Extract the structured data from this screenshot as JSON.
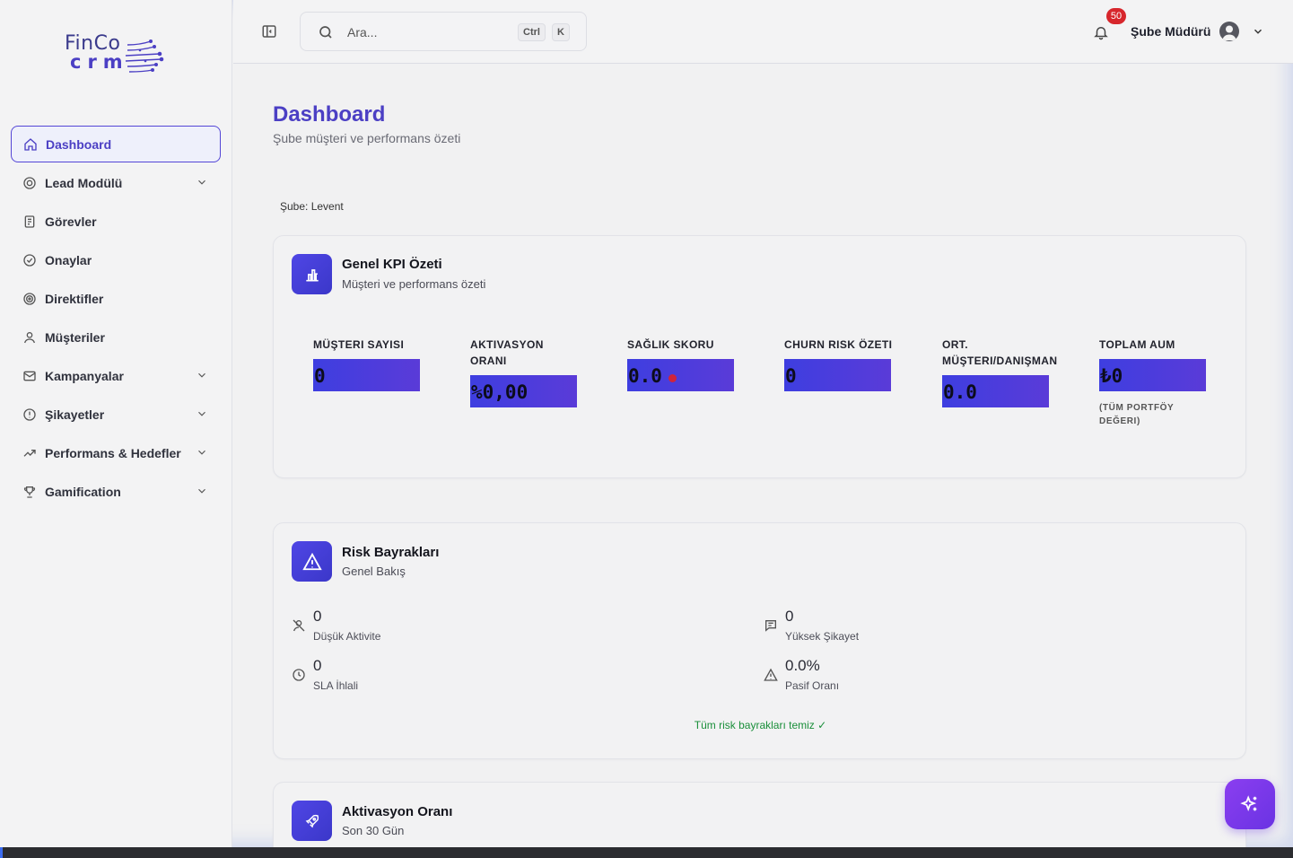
{
  "brand": {
    "line1": "FinCo",
    "line2": "crm"
  },
  "sidebar": {
    "items": [
      {
        "label": "Dashboard",
        "icon": "home-icon",
        "active": true,
        "has_children": false
      },
      {
        "label": "Lead Modülü",
        "icon": "target-icon",
        "has_children": true
      },
      {
        "label": "Görevler",
        "icon": "clipboard-icon",
        "has_children": false
      },
      {
        "label": "Onaylar",
        "icon": "check-circle-icon",
        "has_children": false
      },
      {
        "label": "Direktifler",
        "icon": "radar-icon",
        "has_children": false
      },
      {
        "label": "Müşteriler",
        "icon": "user-icon",
        "has_children": false
      },
      {
        "label": "Kampanyalar",
        "icon": "mail-icon",
        "has_children": true
      },
      {
        "label": "Şikayetler",
        "icon": "alert-circle-icon",
        "has_children": true
      },
      {
        "label": "Performans & Hedefler",
        "icon": "trending-up-icon",
        "has_children": true
      },
      {
        "label": "Gamification",
        "icon": "trophy-icon",
        "has_children": true
      }
    ]
  },
  "topbar": {
    "search_placeholder": "Ara...",
    "shortcut_ctrl": "Ctrl",
    "shortcut_key": "K",
    "notification_count": "50",
    "user_role": "Şube Müdürü"
  },
  "page": {
    "title": "Dashboard",
    "subtitle": "Şube müşteri ve performans özeti",
    "branch": "Şube: Levent"
  },
  "kpi_card": {
    "title": "Genel KPI Özeti",
    "subtitle": "Müşteri ve performans özeti",
    "items": [
      {
        "label": "Müşteri Sayısı",
        "value": "0",
        "note": ""
      },
      {
        "label": "Aktivasyon Oranı",
        "value": "%0,00",
        "note": ""
      },
      {
        "label": "Sağlık Skoru",
        "value": "0.0",
        "note": "",
        "status_color": "#d0243b"
      },
      {
        "label": "Churn Risk Özeti",
        "value": "0",
        "note": ""
      },
      {
        "label": "Ort. Müşteri/Danışman",
        "value": "0.0",
        "note": ""
      },
      {
        "label": "Toplam AUM",
        "value": "₺0",
        "note": "(Tüm Portföy Değeri)"
      }
    ]
  },
  "risk_card": {
    "title": "Risk Bayrakları",
    "subtitle": "Genel Bakış",
    "items": [
      {
        "value": "0",
        "label": "Düşük Aktivite",
        "icon": "user-off-icon"
      },
      {
        "value": "0",
        "label": "Yüksek Şikayet",
        "icon": "message-alert-icon"
      },
      {
        "value": "0",
        "label": "SLA İhlali",
        "icon": "clock-icon"
      },
      {
        "value": "0.0%",
        "label": "Pasif Oranı",
        "icon": "warning-triangle-icon"
      }
    ],
    "status_text": "Tüm risk bayrakları temiz ✓"
  },
  "activation_card": {
    "title": "Aktivasyon Oranı",
    "subtitle": "Son 30 Gün"
  },
  "colors": {
    "accent": "#4b3fc4",
    "kpi_bar": "#4a3fe0",
    "badge": "#d7262c",
    "success": "#1a8f3a",
    "fab": "#7b3aea"
  }
}
